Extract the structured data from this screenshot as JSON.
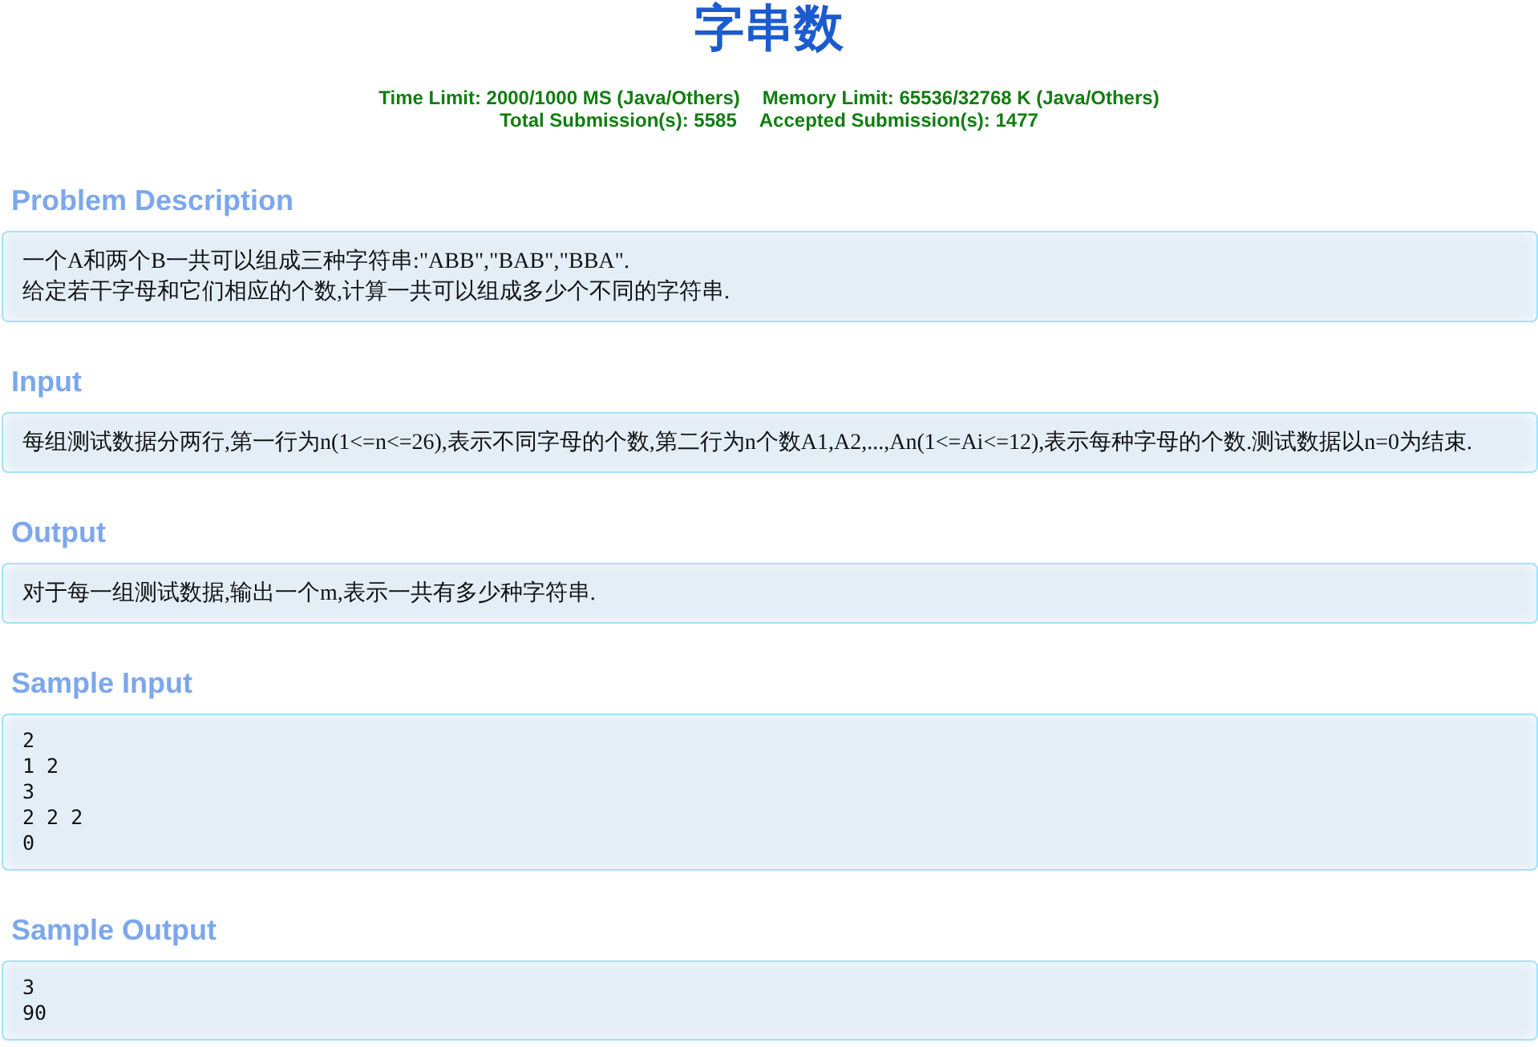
{
  "title": "字串数",
  "info_lines": [
    [
      "Time Limit: 2000/1000 MS (Java/Others)",
      "Memory Limit: 65536/32768 K (Java/Others)"
    ],
    [
      "Total Submission(s): 5585",
      "Accepted Submission(s): 1477"
    ]
  ],
  "sections": [
    {
      "heading": "Problem Description",
      "kind": "text",
      "lines": [
        "一个A和两个B一共可以组成三种字符串:\"ABB\",\"BAB\",\"BBA\".",
        "给定若干字母和它们相应的个数,计算一共可以组成多少个不同的字符串."
      ]
    },
    {
      "heading": "Input",
      "kind": "text",
      "lines": [
        "每组测试数据分两行,第一行为n(1<=n<=26),表示不同字母的个数,第二行为n个数A1,A2,...,An(1<=Ai<=12),表示每种字母的个数.测试数据以n=0为结束."
      ]
    },
    {
      "heading": "Output",
      "kind": "text",
      "lines": [
        "对于每一组测试数据,输出一个m,表示一共有多少种字符串."
      ]
    },
    {
      "heading": "Sample Input",
      "kind": "code",
      "lines": [
        "2",
        "1 2",
        "3",
        "2 2 2",
        "0"
      ]
    },
    {
      "heading": "Sample Output",
      "kind": "code",
      "lines": [
        "3",
        "90"
      ]
    }
  ]
}
